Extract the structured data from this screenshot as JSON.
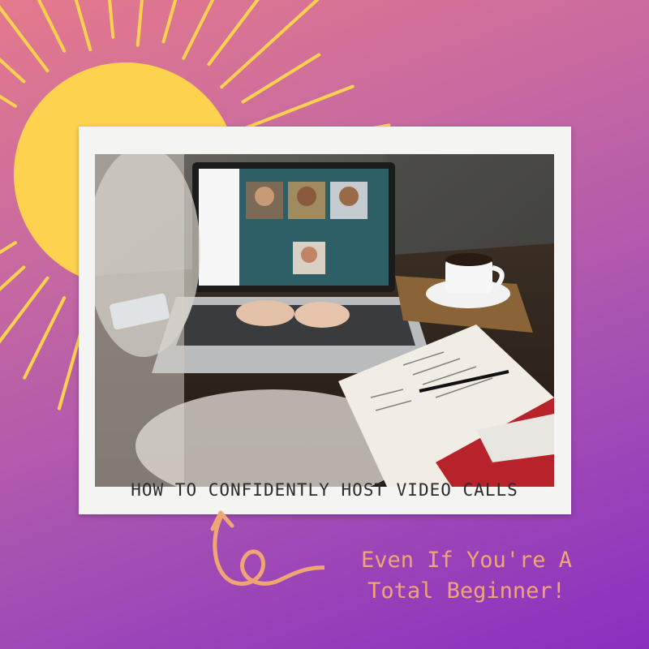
{
  "caption": "HOW TO CONFIDENTLY HOST VIDEO CALLS",
  "subtitle": {
    "line1": "Even If You're A",
    "line2": "Total Beginner!"
  },
  "colors": {
    "sun": "#fdd24f",
    "subtitle": "#f0a674",
    "arrow": "#f0a674",
    "frame": "#f4f4f2",
    "caption_text": "#2b2b2b"
  },
  "icons": [
    "sun-icon",
    "curly-arrow-icon"
  ]
}
